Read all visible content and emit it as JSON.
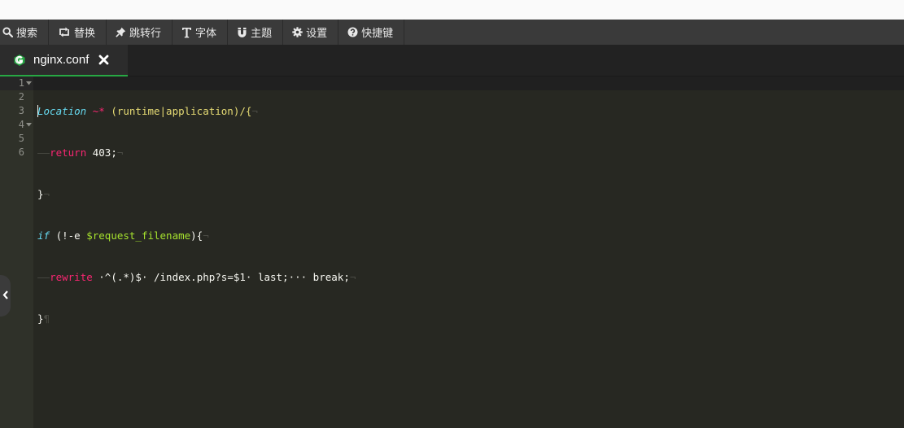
{
  "toolbar": {
    "items": [
      {
        "label": "搜索",
        "icon": "search-icon"
      },
      {
        "label": "替换",
        "icon": "replace-icon"
      },
      {
        "label": "跳转行",
        "icon": "pin-icon"
      },
      {
        "label": "字体",
        "icon": "font-icon"
      },
      {
        "label": "主题",
        "icon": "magnet-icon"
      },
      {
        "label": "设置",
        "icon": "gear-icon"
      },
      {
        "label": "快捷键",
        "icon": "question-icon"
      }
    ]
  },
  "tab": {
    "filename": "nginx.conf",
    "icon": "file-type-icon",
    "close_icon": "close-icon",
    "accent_color": "#27a844"
  },
  "editor": {
    "line_numbers": [
      "1",
      "2",
      "3",
      "4",
      "5",
      "6"
    ],
    "theme": {
      "background": "#272822",
      "gutter": "#2f3129"
    },
    "lines": [
      {
        "t1": "Location",
        "t2": " ~*",
        "t3": " (runtime|application)/{",
        "end": "¬"
      },
      {
        "indent": "——",
        "t1": "return",
        "t2": " 403;",
        "end": "¬"
      },
      {
        "t1": "}",
        "end": "¬"
      },
      {
        "t1": "if",
        "t2": " (!-e ",
        "t3": "$request_filename",
        "t4": "){",
        "end": "¬"
      },
      {
        "indent": "——",
        "t1": "rewrite",
        "t2": " ·^(.*)$·",
        "t3": " /index.php?s=$1·",
        "t4": " last;·",
        "t5": "·· break;",
        "end": "¬"
      },
      {
        "t1": "}",
        "end": "¶"
      }
    ]
  },
  "side_handle": {
    "icon": "chevron-left-icon"
  }
}
